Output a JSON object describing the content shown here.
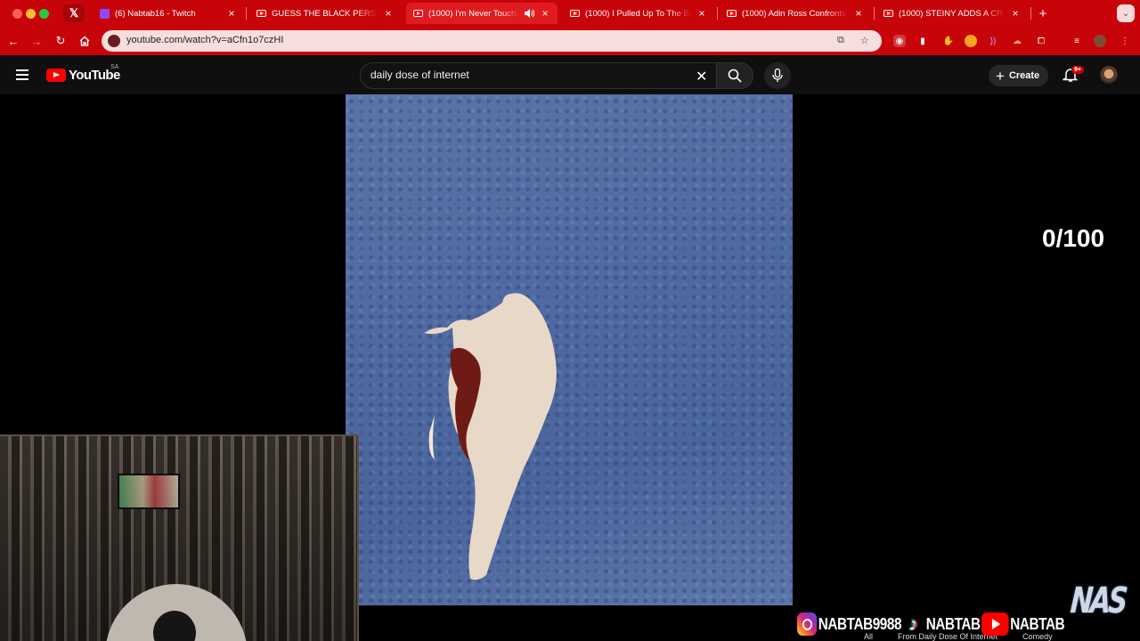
{
  "browser": {
    "x_tab": {
      "icon": "x-logo-icon"
    },
    "tabs": [
      {
        "title": "(6) Nabtab16 - Twitch",
        "favicon": "twitch-icon"
      },
      {
        "title": "GUESS THE BLACK PERSON",
        "favicon": "youtube-icon"
      },
      {
        "title": "(1000) I'm Never Touching",
        "favicon": "youtube-icon",
        "active": true,
        "audio": true
      },
      {
        "title": "(1000) I Pulled Up To The BE",
        "favicon": "youtube-icon"
      },
      {
        "title": "(1000) Adin Ross Confronts",
        "favicon": "youtube-icon"
      },
      {
        "title": "(1000) STEINY ADDS A CRAZ",
        "favicon": "youtube-icon"
      }
    ],
    "url": "youtube.com/watch?v=aCfn1o7czHI",
    "accent": "#c8040b"
  },
  "youtube": {
    "logo_text": "YouTube",
    "region": "SA",
    "search_value": "daily dose of internet",
    "create_label": "Create",
    "notification_badge": "9+"
  },
  "stream": {
    "counter": "0/100",
    "socials": [
      {
        "platform": "instagram",
        "handle": "NABTAB9988"
      },
      {
        "platform": "tiktok",
        "handle": "NABTAB"
      },
      {
        "platform": "youtube",
        "handle": "NABTAB"
      }
    ],
    "chips": [
      "All",
      "From Daily Dose Of Internet",
      "Comedy"
    ],
    "logo": "NAS"
  }
}
